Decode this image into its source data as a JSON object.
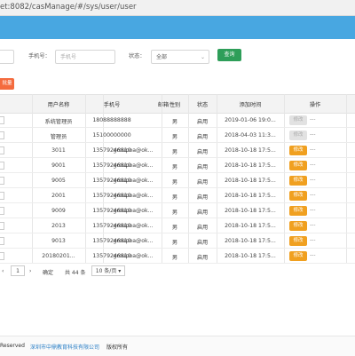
{
  "browser": {
    "url": "et:8082/casManage/#/sys/user/user"
  },
  "filters": {
    "phone_label": "手机号：",
    "phone_placeholder": "手机号",
    "status_label": "状态：",
    "status_value": "全部",
    "search_label": "查询",
    "delete_label": "批量删除"
  },
  "table": {
    "columns": [
      "用户名称",
      "手机号",
      "邮箱",
      "性别",
      "状态",
      "添加时间",
      "操作"
    ],
    "rows": [
      {
        "name": "系统管理员",
        "phone": "18088888888",
        "email": "",
        "gender": "男",
        "status": "启用",
        "time": "2019-01-06 19:0...",
        "op": "修改",
        "op_enabled": false
      },
      {
        "name": "管理员",
        "phone": "15100000000",
        "email": "",
        "gender": "男",
        "status": "启用",
        "time": "2018-04-03 11:3...",
        "op": "修改",
        "op_enabled": false
      },
      {
        "name": "3011",
        "phone": "13579246810",
        "email": "groupoa@ok...",
        "gender": "男",
        "status": "启用",
        "time": "2018-10-18 17:5...",
        "op": "修改",
        "op_enabled": true
      },
      {
        "name": "9001",
        "phone": "13579246810",
        "email": "groupoa@ok...",
        "gender": "男",
        "status": "启用",
        "time": "2018-10-18 17:5...",
        "op": "修改",
        "op_enabled": true
      },
      {
        "name": "9005",
        "phone": "13579246810",
        "email": "groupoa@ok...",
        "gender": "男",
        "status": "启用",
        "time": "2018-10-18 17:5...",
        "op": "修改",
        "op_enabled": true
      },
      {
        "name": "2001",
        "phone": "13579246810",
        "email": "groupoa@ok...",
        "gender": "男",
        "status": "启用",
        "time": "2018-10-18 17:5...",
        "op": "修改",
        "op_enabled": true
      },
      {
        "name": "9009",
        "phone": "13579246810",
        "email": "groupoa@ok...",
        "gender": "男",
        "status": "启用",
        "time": "2018-10-18 17:5...",
        "op": "修改",
        "op_enabled": true
      },
      {
        "name": "2013",
        "phone": "13579246810",
        "email": "groupoa@ok...",
        "gender": "男",
        "status": "启用",
        "time": "2018-10-18 17:5...",
        "op": "修改",
        "op_enabled": true
      },
      {
        "name": "9013",
        "phone": "13579246810",
        "email": "groupoa@ok...",
        "gender": "男",
        "status": "启用",
        "time": "2018-10-18 17:5...",
        "op": "修改",
        "op_enabled": true
      },
      {
        "name": "20180201...",
        "phone": "13579246810",
        "email": "groupoa@ok...",
        "gender": "男",
        "status": "启用",
        "time": "2018-10-18 17:5...",
        "op": "修改",
        "op_enabled": true
      }
    ],
    "more": "---"
  },
  "pagination": {
    "page": "1",
    "confirm": "确定",
    "total": "共 44 条",
    "page_size": "10 条/页 ▾"
  },
  "footer": {
    "reserved": "Reserved",
    "company": "深圳市中鼎教育科技有限公司",
    "rights": "版权所有"
  },
  "colors": {
    "header_band": "#48a7e1",
    "search_button": "#2e9e59",
    "edit_button": "#f0a020",
    "delete_button": "#f46b3e",
    "status_enabled": "#2e9e59"
  }
}
